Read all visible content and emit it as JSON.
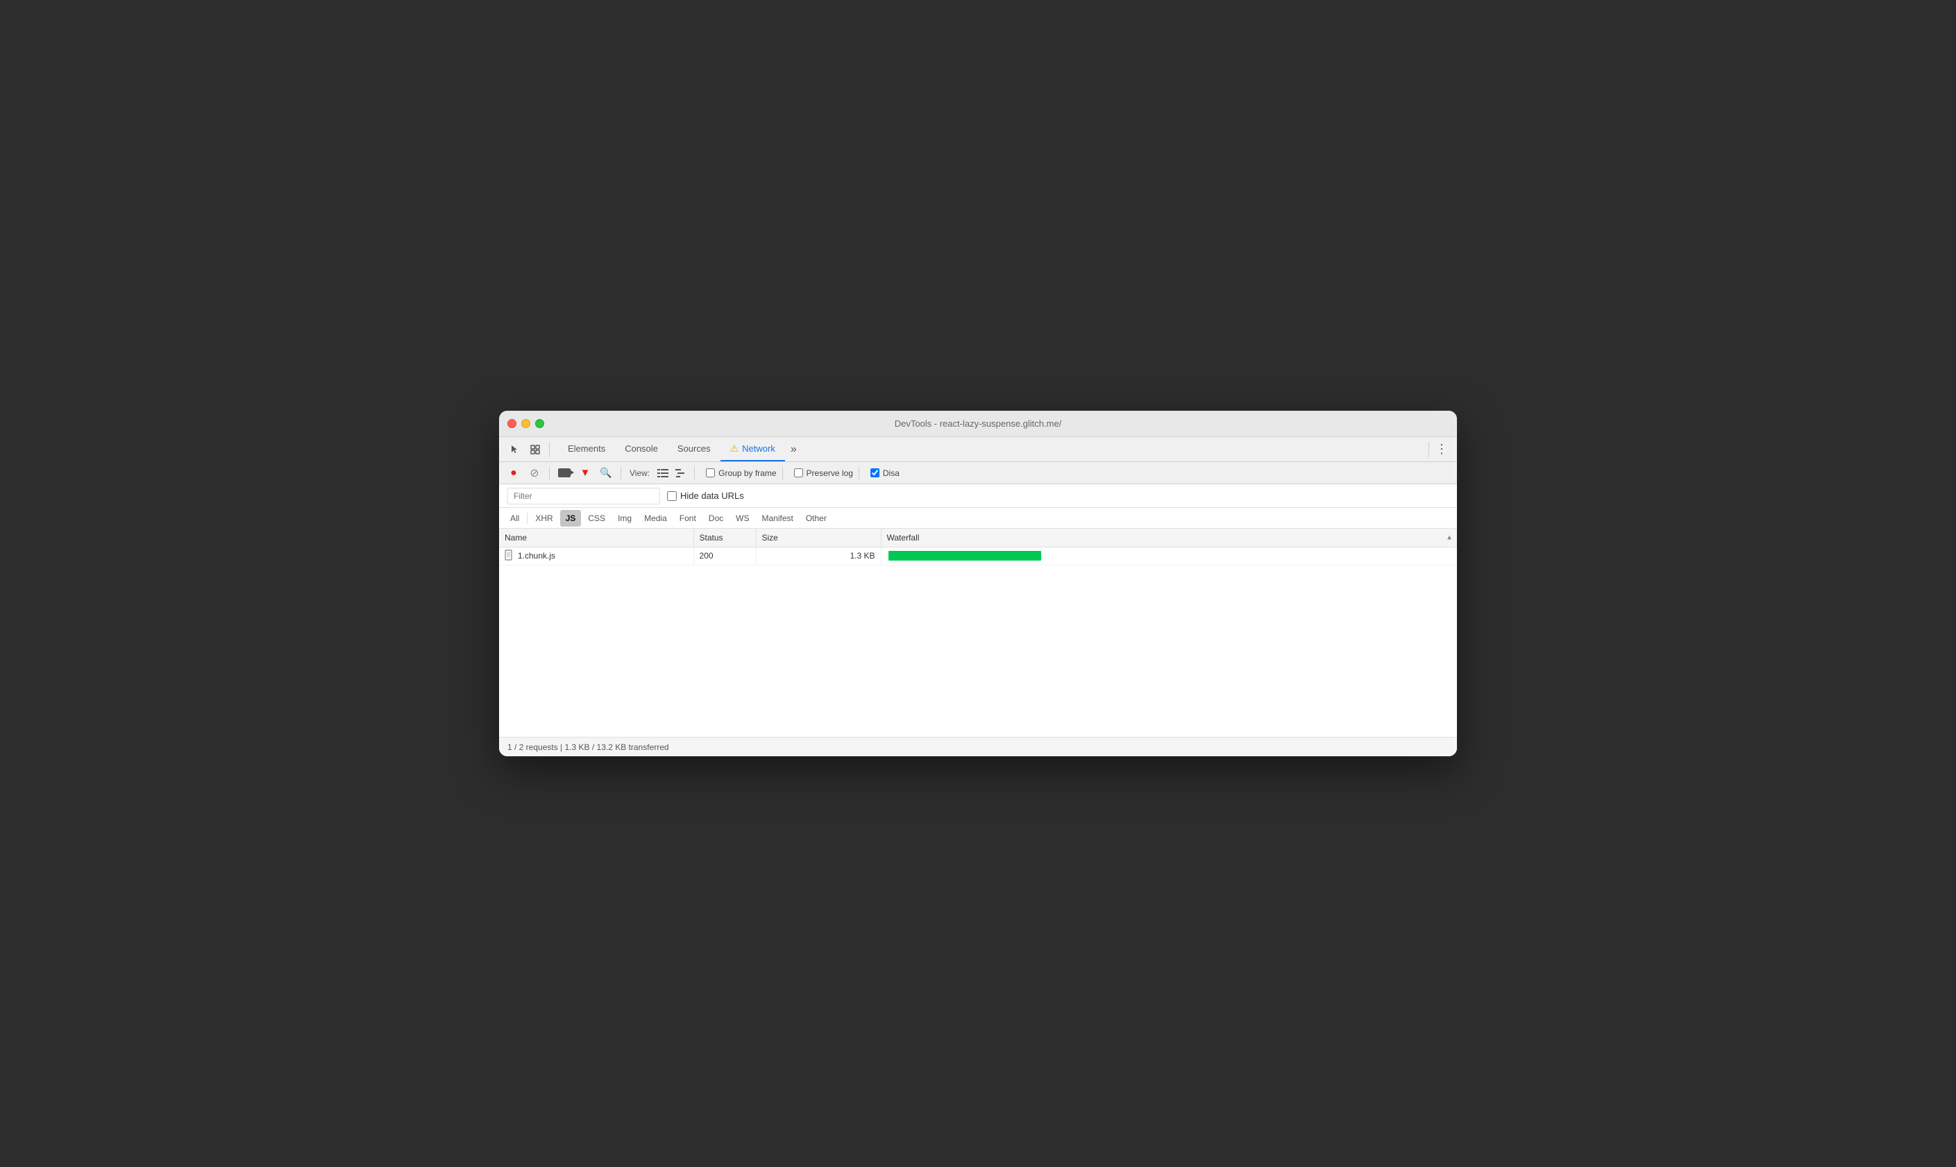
{
  "window": {
    "title": "DevTools - react-lazy-suspense.glitch.me/"
  },
  "traffic_lights": {
    "red": "close",
    "yellow": "minimize",
    "green": "maximize"
  },
  "tabs": [
    {
      "id": "elements",
      "label": "Elements",
      "active": false
    },
    {
      "id": "console",
      "label": "Console",
      "active": false
    },
    {
      "id": "sources",
      "label": "Sources",
      "active": false
    },
    {
      "id": "network",
      "label": "Network",
      "active": true
    },
    {
      "id": "more",
      "label": "»",
      "active": false
    }
  ],
  "toolbar": {
    "view_label": "View:",
    "group_by_frame_label": "Group by frame",
    "preserve_log_label": "Preserve log",
    "disable_cache_label": "Disa",
    "group_by_frame_checked": false,
    "preserve_log_checked": false,
    "disable_cache_checked": true
  },
  "filter_bar": {
    "filter_placeholder": "Filter",
    "hide_data_urls_label": "Hide data URLs",
    "hide_data_urls_checked": false
  },
  "type_filters": [
    {
      "id": "all",
      "label": "All",
      "active": false
    },
    {
      "id": "xhr",
      "label": "XHR",
      "active": false
    },
    {
      "id": "js",
      "label": "JS",
      "active": true
    },
    {
      "id": "css",
      "label": "CSS",
      "active": false
    },
    {
      "id": "img",
      "label": "Img",
      "active": false
    },
    {
      "id": "media",
      "label": "Media",
      "active": false
    },
    {
      "id": "font",
      "label": "Font",
      "active": false
    },
    {
      "id": "doc",
      "label": "Doc",
      "active": false
    },
    {
      "id": "ws",
      "label": "WS",
      "active": false
    },
    {
      "id": "manifest",
      "label": "Manifest",
      "active": false
    },
    {
      "id": "other",
      "label": "Other",
      "active": false
    }
  ],
  "table": {
    "columns": [
      {
        "id": "name",
        "label": "Name",
        "sort": true
      },
      {
        "id": "status",
        "label": "Status",
        "sort": false
      },
      {
        "id": "size",
        "label": "Size",
        "sort": false
      },
      {
        "id": "waterfall",
        "label": "Waterfall",
        "sort": true
      }
    ],
    "rows": [
      {
        "name": "1.chunk.js",
        "status": "200",
        "size": "1.3 KB",
        "has_waterfall": true,
        "waterfall_width": 220,
        "waterfall_color": "#00c853"
      }
    ]
  },
  "status_bar": {
    "text": "1 / 2 requests | 1.3 KB / 13.2 KB transferred"
  }
}
